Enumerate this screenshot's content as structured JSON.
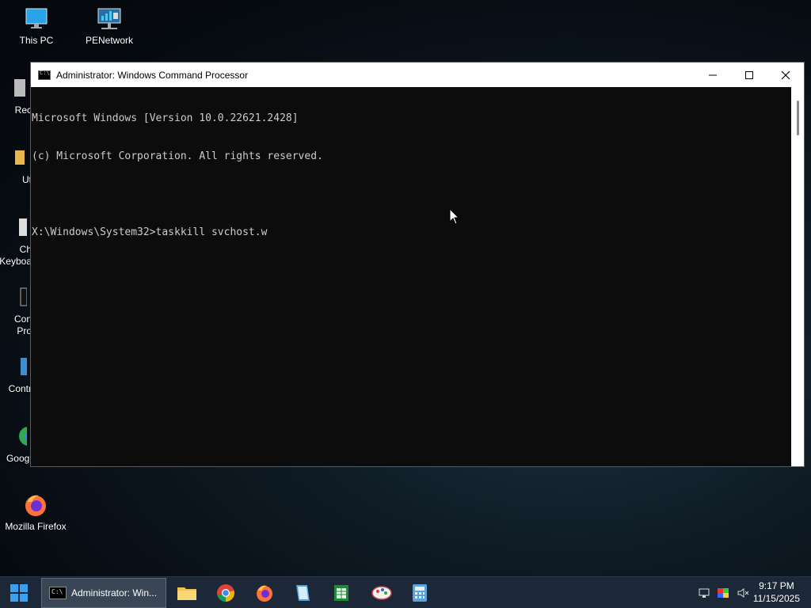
{
  "desktop": {
    "icons": [
      {
        "label": "This PC",
        "icon": "monitor-icon"
      },
      {
        "label": "PENetwork",
        "icon": "network-icon"
      },
      {
        "label": "Recy",
        "icon": "recycle-bin-icon"
      },
      {
        "label": "Ut",
        "icon": "folder-icon"
      },
      {
        "label": "Ch\nKeyboa",
        "icon": "keyboard-icon"
      },
      {
        "label": "Con\nPro",
        "icon": "cmd-icon"
      },
      {
        "label": "Contr",
        "icon": "control-panel-icon"
      },
      {
        "label": "Googl",
        "icon": "chrome-icon"
      },
      {
        "label": "Mozilla Firefox",
        "icon": "firefox-icon"
      }
    ]
  },
  "window": {
    "title": "Administrator: Windows Command Processor",
    "console_lines": [
      "Microsoft Windows [Version 10.0.22621.2428]",
      "(c) Microsoft Corporation. All rights reserved.",
      "",
      "X:\\Windows\\System32>taskkill svchost.w"
    ]
  },
  "taskbar": {
    "active_task_label": "Administrator: Win...",
    "pinned": [
      "file-explorer-icon",
      "chrome-icon",
      "firefox-icon",
      "notepad-icon",
      "spreadsheet-icon",
      "paint-icon",
      "calculator-icon"
    ],
    "time": "9:17 PM",
    "date": "11/15/2025"
  },
  "colors": {
    "console_bg": "#0c0c0c",
    "console_text": "#cccccc",
    "taskbar_bg": "#1c2838"
  }
}
